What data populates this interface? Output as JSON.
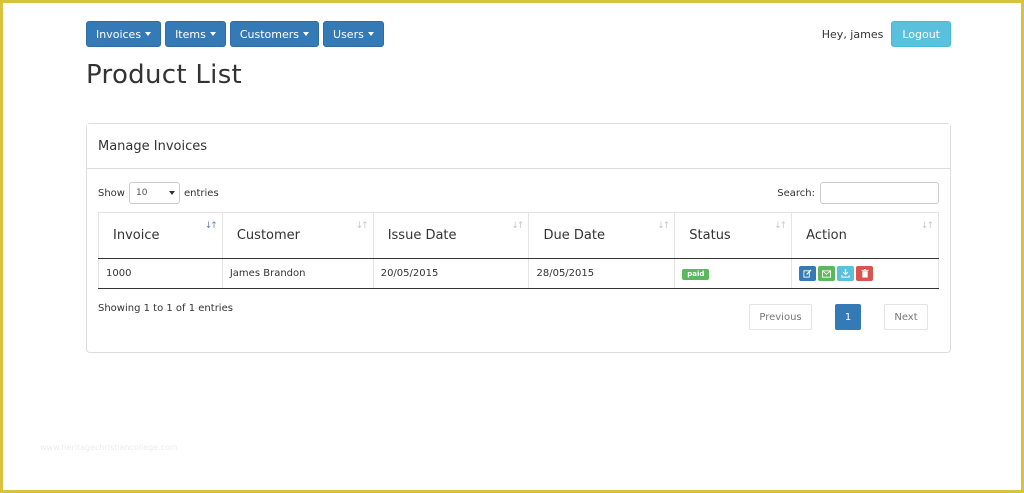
{
  "nav": {
    "items": [
      {
        "label": "Invoices"
      },
      {
        "label": "Items"
      },
      {
        "label": "Customers"
      },
      {
        "label": "Users"
      }
    ],
    "greeting": "Hey, james",
    "logout_label": "Logout"
  },
  "page": {
    "title": "Product List"
  },
  "panel": {
    "heading": "Manage Invoices",
    "show_label": "Show",
    "entries_value": "10",
    "entries_label": "entries",
    "search_label": "Search:",
    "search_value": ""
  },
  "table": {
    "columns": [
      "Invoice",
      "Customer",
      "Issue Date",
      "Due Date",
      "Status",
      "Action"
    ],
    "rows": [
      {
        "invoice": "1000",
        "customer": "James Brandon",
        "issue_date": "20/05/2015",
        "due_date": "28/05/2015",
        "status": "paid"
      }
    ],
    "info": "Showing 1 to 1 of 1 entries"
  },
  "pagination": {
    "previous": "Previous",
    "current": "1",
    "next": "Next"
  },
  "watermark": "www.heritagechristiancollege.com",
  "colors": {
    "primary": "#337ab7",
    "info": "#5bc0de",
    "success": "#5cb85c",
    "danger": "#d9534f",
    "frame": "#d9c23c"
  }
}
